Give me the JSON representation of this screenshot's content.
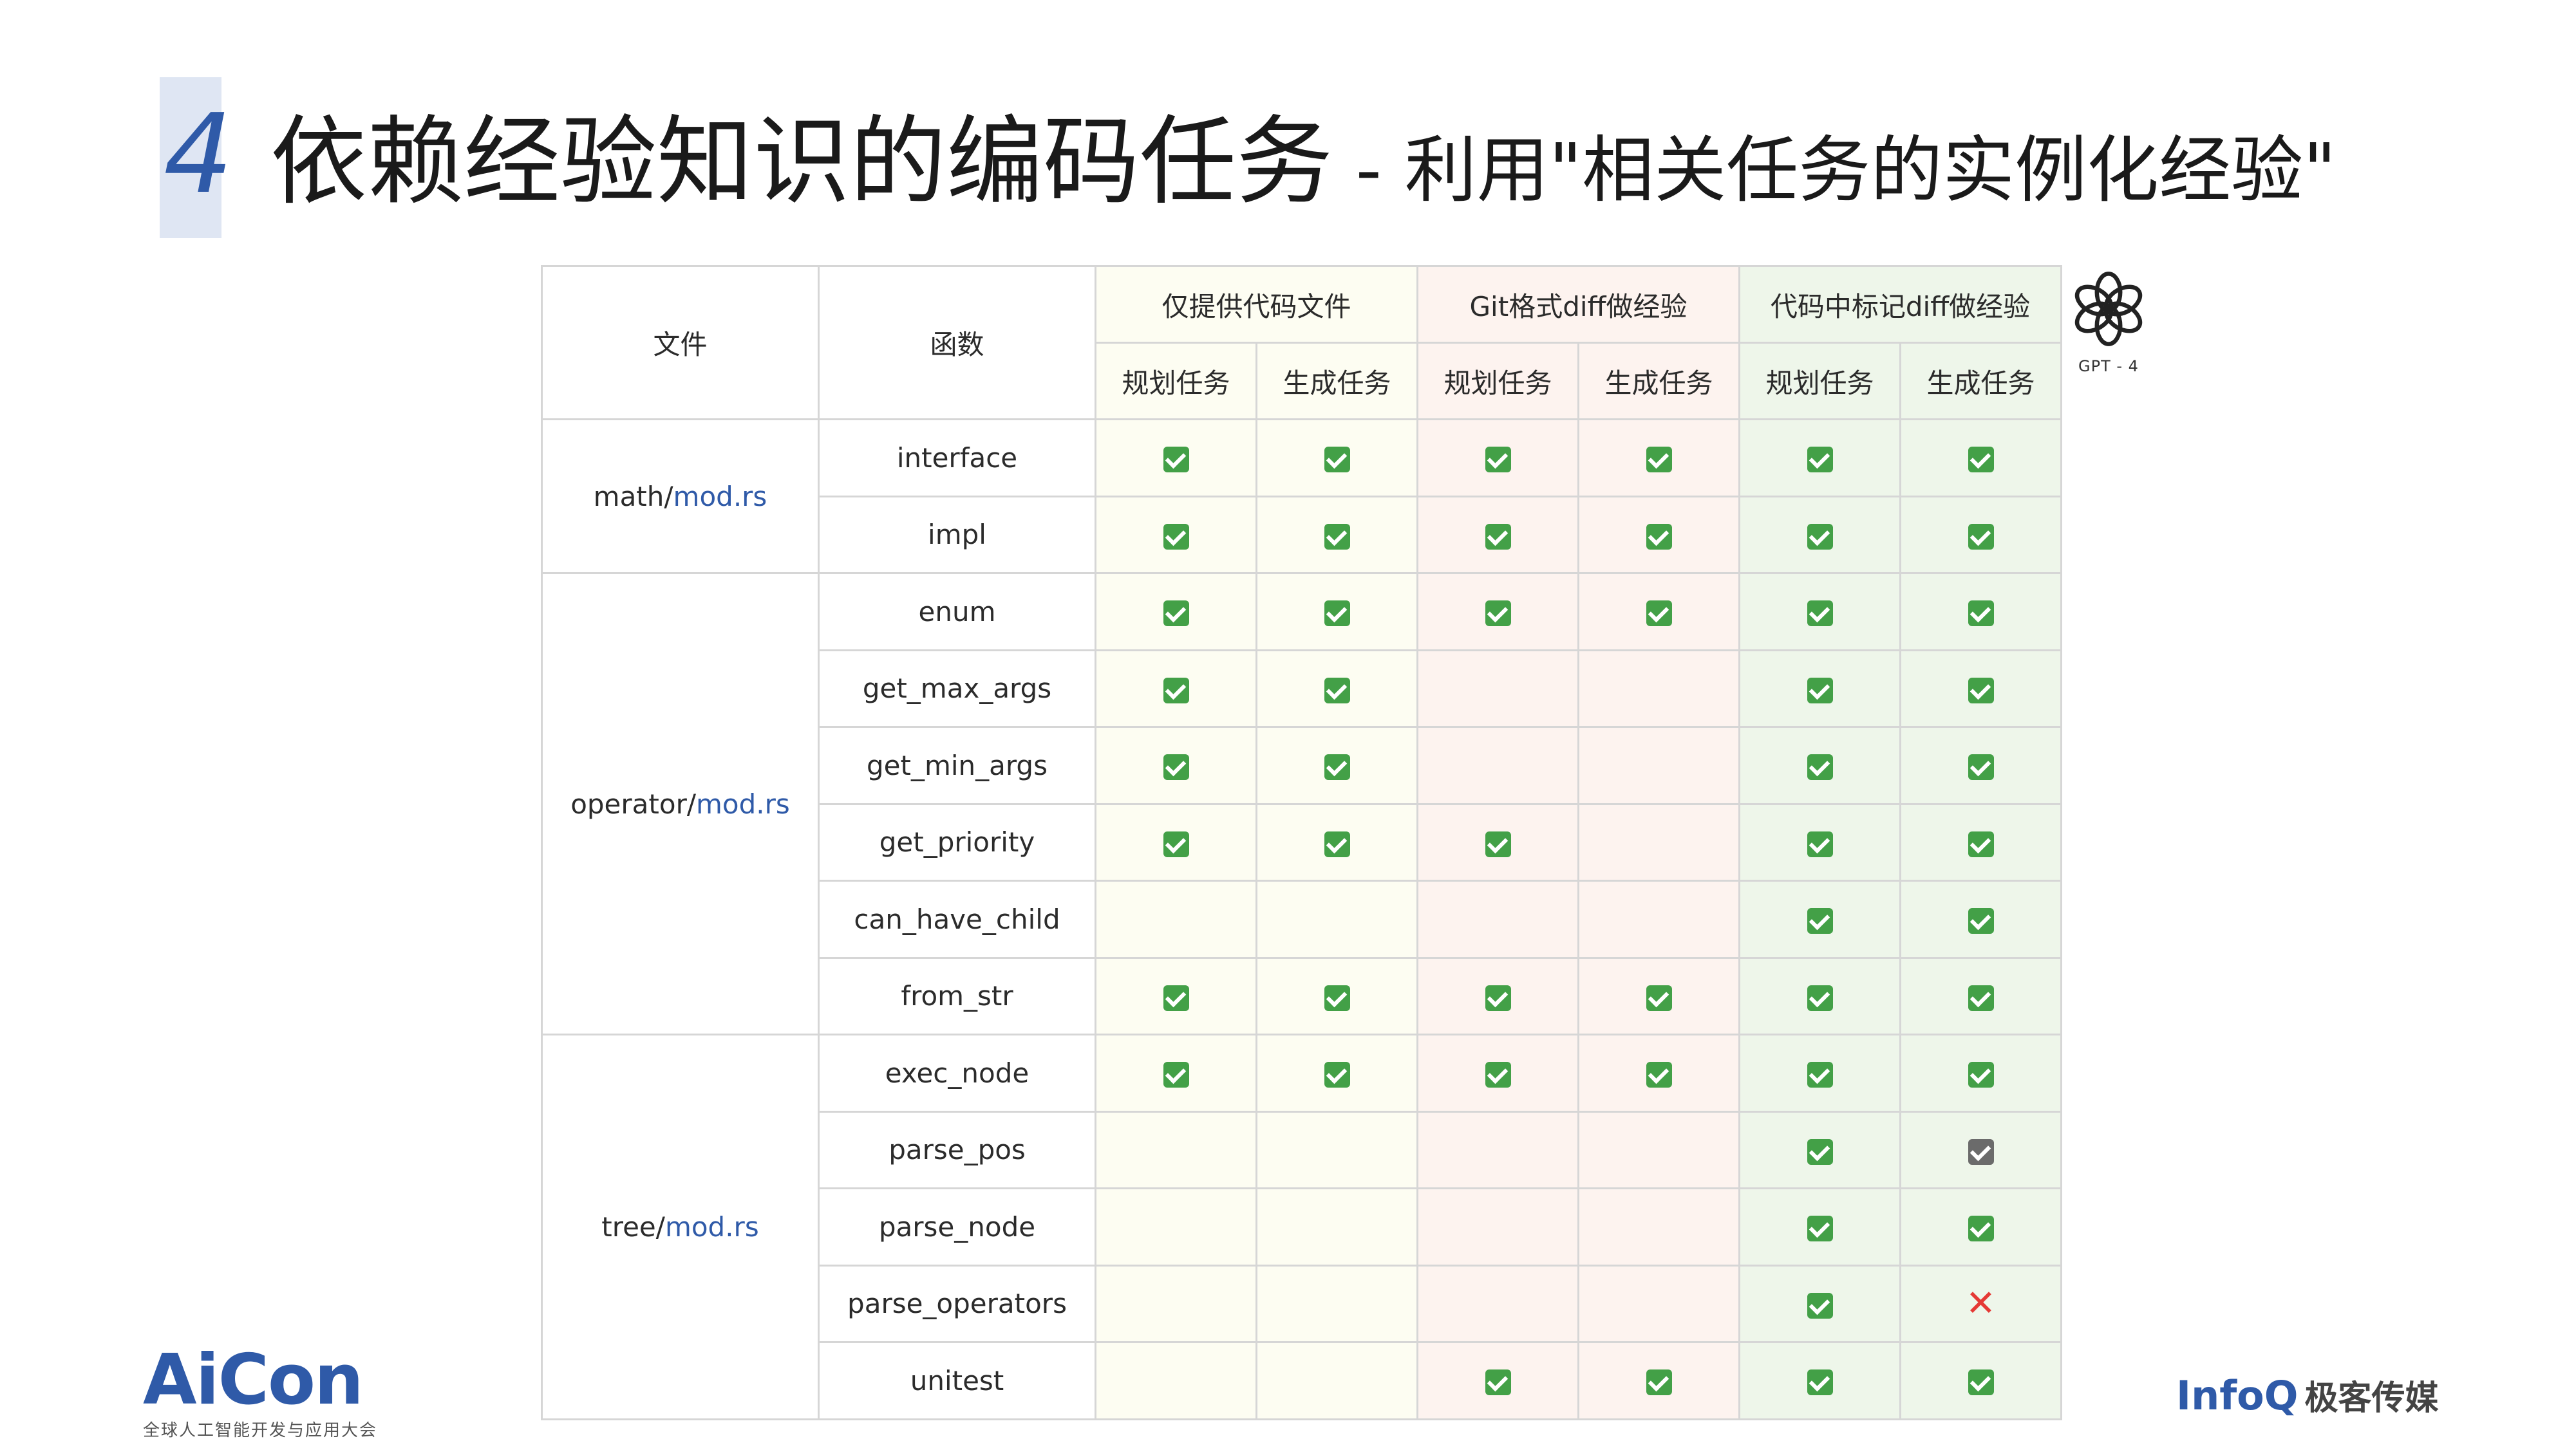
{
  "title": {
    "number": "4",
    "main": "依赖经验知识的编码任务",
    "separator": " - ",
    "sub": "利用\"相关任务的实例化经验\""
  },
  "table": {
    "col_file": "文件",
    "col_function": "函数",
    "groups": [
      "仅提供代码文件",
      "Git格式diff做经验",
      "代码中标记diff做经验"
    ],
    "subcols": [
      "规划任务",
      "生成任务",
      "规划任务",
      "生成任务",
      "规划任务",
      "生成任务"
    ],
    "files": [
      {
        "dir": "math/",
        "file": "mod.rs"
      },
      {
        "dir": "operator/",
        "file": "mod.rs"
      },
      {
        "dir": "tree/",
        "file": "mod.rs"
      }
    ],
    "rows": [
      {
        "fn": "interface",
        "marks": [
          "check",
          "check",
          "check",
          "check",
          "check",
          "check"
        ]
      },
      {
        "fn": "impl",
        "marks": [
          "check",
          "check",
          "check",
          "check",
          "check",
          "check"
        ]
      },
      {
        "fn": "enum",
        "marks": [
          "check",
          "check",
          "check",
          "check",
          "check",
          "check"
        ]
      },
      {
        "fn": "get_max_args",
        "marks": [
          "check",
          "check",
          "",
          "",
          "check",
          "check"
        ]
      },
      {
        "fn": "get_min_args",
        "marks": [
          "check",
          "check",
          "",
          "",
          "check",
          "check"
        ]
      },
      {
        "fn": "get_priority",
        "marks": [
          "check",
          "check",
          "check",
          "",
          "check",
          "check"
        ]
      },
      {
        "fn": "can_have_child",
        "marks": [
          "",
          "",
          "",
          "",
          "check",
          "check"
        ]
      },
      {
        "fn": "from_str",
        "marks": [
          "check",
          "check",
          "check",
          "check",
          "check",
          "check"
        ]
      },
      {
        "fn": "exec_node",
        "marks": [
          "check",
          "check",
          "check",
          "check",
          "check",
          "check"
        ]
      },
      {
        "fn": "parse_pos",
        "marks": [
          "",
          "",
          "",
          "",
          "check",
          "partial"
        ]
      },
      {
        "fn": "parse_node",
        "marks": [
          "",
          "",
          "",
          "",
          "check",
          "check"
        ]
      },
      {
        "fn": "parse_operators",
        "marks": [
          "",
          "",
          "",
          "",
          "check",
          "cross"
        ]
      },
      {
        "fn": "unitest",
        "marks": [
          "",
          "",
          "check",
          "check",
          "check",
          "check"
        ]
      }
    ]
  },
  "model_label": "GPT - 4",
  "footer": {
    "aicon_name": "AiCon",
    "aicon_sub": "全球人工智能开发与应用大会",
    "infoq_name": "InfoQ",
    "infoq_cn": "极客传媒"
  },
  "colors": {
    "accent": "#2f5aa8",
    "check": "#43a047",
    "cross": "#e53935",
    "group1_bg": "#fdfdf2",
    "group2_bg": "#fdf3ef",
    "group3_bg": "#eef6ea"
  }
}
